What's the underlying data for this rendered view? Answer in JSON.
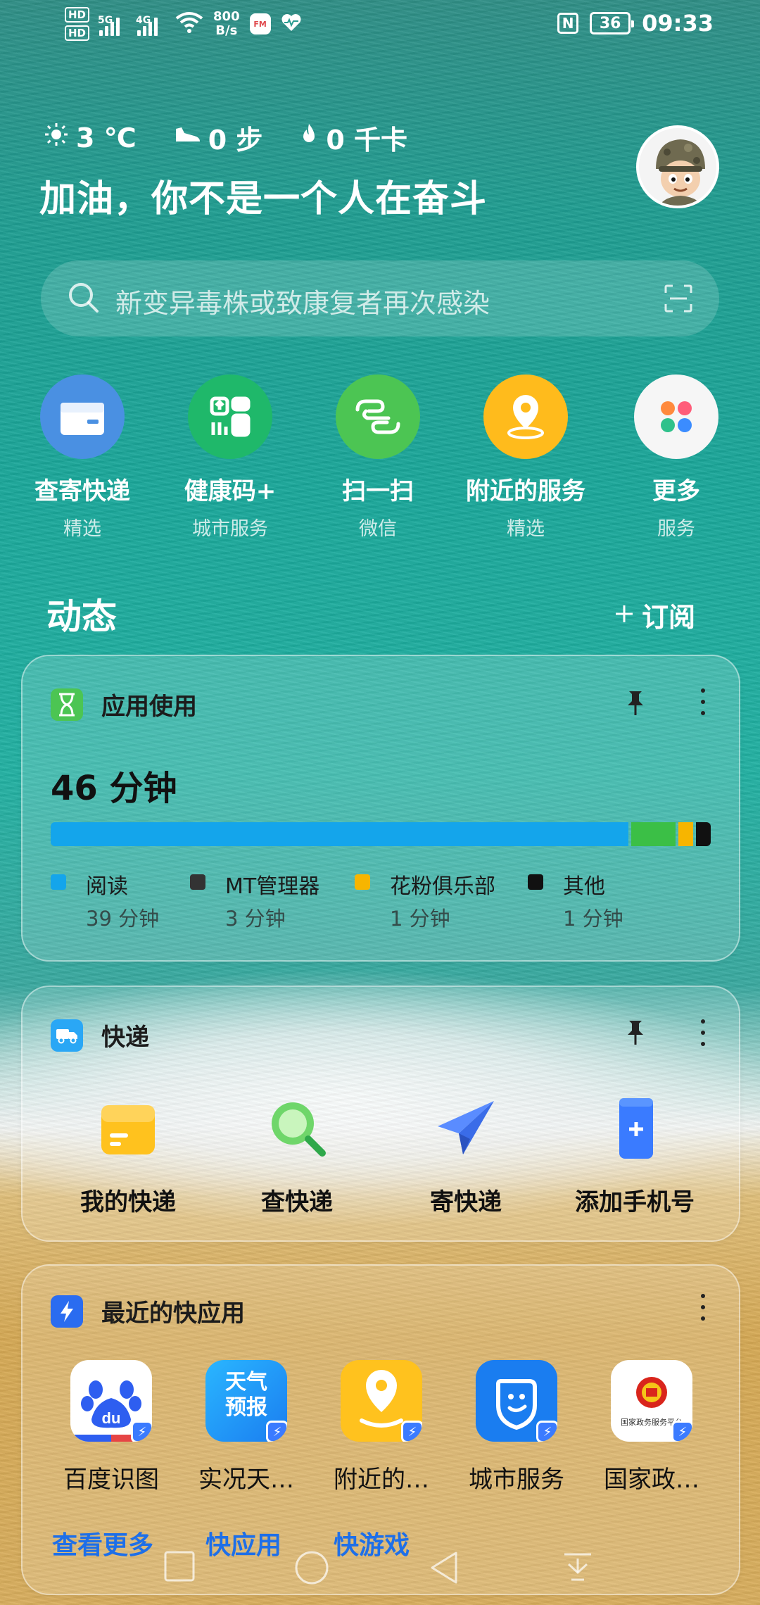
{
  "status_bar": {
    "hd1": "HD",
    "hd2": "HD",
    "net1": "5G",
    "net2": "4G",
    "speed_value": "800",
    "speed_unit": "B/s",
    "fm_label": "FM",
    "nfc": "N",
    "battery": "36",
    "time": "09:33"
  },
  "header": {
    "temperature": "3 ℃",
    "steps": "0 步",
    "calories": "0 千卡",
    "greeting": "加油，你不是一个人在奋斗"
  },
  "search": {
    "placeholder": "新变异毒株或致康复者再次感染"
  },
  "services": [
    {
      "name": "查寄快递",
      "sub": "精选",
      "color": "#4a90e2"
    },
    {
      "name": "健康码+",
      "sub": "城市服务",
      "color": "#1fb86a"
    },
    {
      "name": "扫一扫",
      "sub": "微信",
      "color": "#4cc553"
    },
    {
      "name": "附近的服务",
      "sub": "精选",
      "color": "#ffbb1c"
    },
    {
      "name": "更多",
      "sub": "服务",
      "color": "#f6f6f6"
    }
  ],
  "dynamic": {
    "title": "动态",
    "subscribe": "订阅"
  },
  "usage_card": {
    "title": "应用使用",
    "total": "46 分钟",
    "apps": [
      {
        "name": "阅读",
        "time": "39 分钟",
        "minutes": 39,
        "color": "#14a5eb"
      },
      {
        "name": "MT管理器",
        "time": "3 分钟",
        "minutes": 3,
        "color": "#3bbf46"
      },
      {
        "name": "花粉俱乐部",
        "time": "1 分钟",
        "minutes": 1,
        "color": "#f7b500"
      },
      {
        "name": "其他",
        "time": "1 分钟",
        "minutes": 1,
        "color": "#111111"
      }
    ],
    "legend_colors": [
      "#14a5eb",
      "#333333",
      "#f7b500",
      "#111111"
    ]
  },
  "express_card": {
    "title": "快递",
    "items": [
      "我的快递",
      "查快递",
      "寄快递",
      "添加手机号"
    ]
  },
  "quick_apps_card": {
    "title": "最近的快应用",
    "apps": [
      "百度识图",
      "实况天…",
      "附近的…",
      "城市服务",
      "国家政…"
    ],
    "weather_icon_text": "天气\n预报",
    "gov_icon_text": "国家政务服务平台",
    "links": [
      "查看更多",
      "快应用",
      "快游戏"
    ]
  }
}
